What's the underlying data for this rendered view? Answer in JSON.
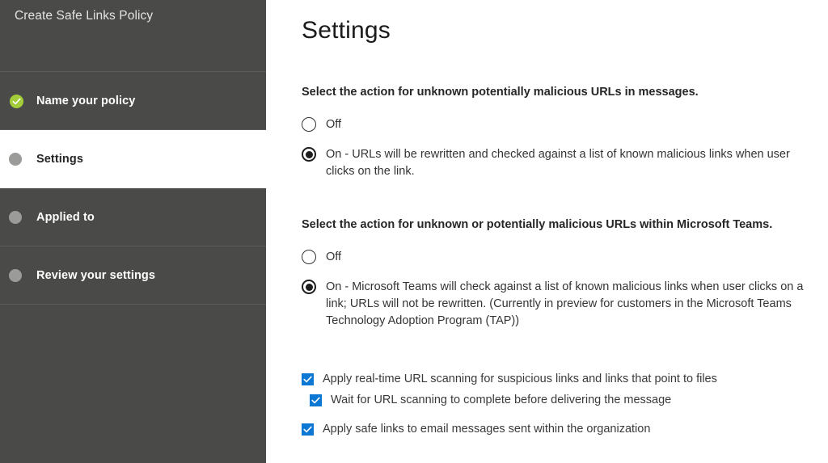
{
  "sidebar": {
    "title": "Create Safe Links Policy",
    "steps": [
      {
        "label": "Name your policy",
        "icon": "check-circle-icon",
        "state": "completed"
      },
      {
        "label": "Settings",
        "icon": "step-dot-icon",
        "state": "active"
      },
      {
        "label": "Applied to",
        "icon": "step-dot-icon",
        "state": "pending"
      },
      {
        "label": "Review your settings",
        "icon": "step-dot-icon",
        "state": "pending"
      }
    ]
  },
  "main": {
    "title": "Settings",
    "sections": [
      {
        "label": "Select the action for unknown potentially malicious URLs in messages.",
        "options": [
          {
            "text": "Off",
            "selected": false
          },
          {
            "text": "On - URLs will be rewritten and checked against a list of known malicious links when user clicks on the link.",
            "selected": true
          }
        ]
      },
      {
        "label": "Select the action for unknown or potentially malicious URLs within Microsoft Teams.",
        "options": [
          {
            "text": "Off",
            "selected": false
          },
          {
            "text": "On - Microsoft Teams will check against a list of known malicious links when user clicks on a link; URLs will not be rewritten. (Currently in preview for customers in the Microsoft Teams Technology Adoption Program (TAP))",
            "selected": true
          }
        ]
      }
    ],
    "checkboxes": [
      {
        "label": "Apply real-time URL scanning for suspicious links and links that point to files",
        "checked": true,
        "indented": false
      },
      {
        "label": "Wait for URL scanning to complete before delivering the message",
        "checked": true,
        "indented": true
      },
      {
        "label": "Apply safe links to email messages sent within the organization",
        "checked": true,
        "indented": false
      }
    ]
  },
  "colors": {
    "sidebar_bg": "#4a4a48",
    "sidebar_active_bg": "#ffffff",
    "completed_green": "#a4ce39",
    "step_dot_gray": "#9b9b99",
    "checkbox_blue": "#0c78d4",
    "text_dark": "#343434"
  }
}
